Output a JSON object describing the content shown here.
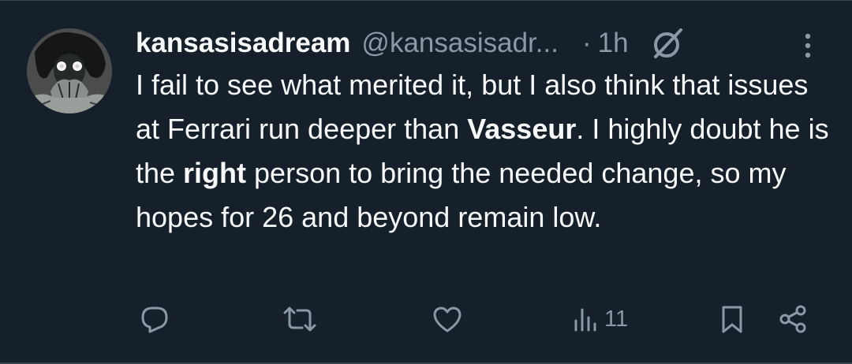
{
  "tweet": {
    "display_name": "kansasisadream",
    "handle": "@kansasisadr...",
    "separator": "·",
    "time": "1h",
    "text_parts": {
      "p1": "I fail to see what merited it, but I also think that issues at Ferrari run deeper than ",
      "p2": "Vasseur",
      "p3": ". I highly doubt he is the ",
      "p4": "right",
      "p5": " person to bring the needed change, so my hopes for 26 and beyond remain low."
    }
  },
  "actions": {
    "views_count": "11"
  },
  "icons": {
    "avatar": "avatar",
    "grok": "no-slash-icon",
    "more": "more-vertical-icon",
    "reply": "reply-icon",
    "retweet": "retweet-icon",
    "like": "heart-icon",
    "views": "views-icon",
    "bookmark": "bookmark-icon",
    "share": "share-icon"
  },
  "colors": {
    "background": "#15202b",
    "primary_text": "#f7f9f9",
    "secondary_text": "#8b98a5",
    "divider": "#38444d"
  }
}
